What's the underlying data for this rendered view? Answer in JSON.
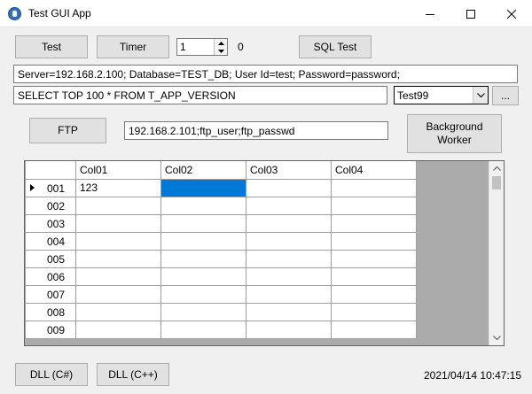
{
  "window": {
    "title": "Test GUI App"
  },
  "controls": {
    "test_label": "Test",
    "timer_label": "Timer",
    "spin_value": "1",
    "counter_value": "0",
    "sql_test_label": "SQL Test",
    "connection_string": "Server=192.168.2.100; Database=TEST_DB; User Id=test; Password=password;",
    "sql_query": "SELECT TOP 100 * FROM T_APP_VERSION",
    "combo_value": "Test99",
    "browse_label": "...",
    "ftp_label": "FTP",
    "ftp_string": "192.168.2.101;ftp_user;ftp_passwd",
    "bg_worker_line1": "Background",
    "bg_worker_line2": "Worker",
    "dll_cs_label": "DLL (C#)",
    "dll_cpp_label": "DLL (C++)",
    "timestamp": "2021/04/14 10:47:15"
  },
  "grid": {
    "columns": [
      "Col01",
      "Col02",
      "Col03",
      "Col04"
    ],
    "rows": [
      {
        "id": "001",
        "cells": [
          "123",
          "",
          "",
          ""
        ]
      },
      {
        "id": "002",
        "cells": [
          "",
          "",
          "",
          ""
        ]
      },
      {
        "id": "003",
        "cells": [
          "",
          "",
          "",
          ""
        ]
      },
      {
        "id": "004",
        "cells": [
          "",
          "",
          "",
          ""
        ]
      },
      {
        "id": "005",
        "cells": [
          "",
          "",
          "",
          ""
        ]
      },
      {
        "id": "006",
        "cells": [
          "",
          "",
          "",
          ""
        ]
      },
      {
        "id": "007",
        "cells": [
          "",
          "",
          "",
          ""
        ]
      },
      {
        "id": "008",
        "cells": [
          "",
          "",
          "",
          ""
        ]
      },
      {
        "id": "009",
        "cells": [
          "",
          "",
          "",
          ""
        ]
      }
    ]
  },
  "colors": {
    "selection": "#0078d7",
    "grid_background": "#ababab",
    "button_face": "#e1e1e1"
  }
}
